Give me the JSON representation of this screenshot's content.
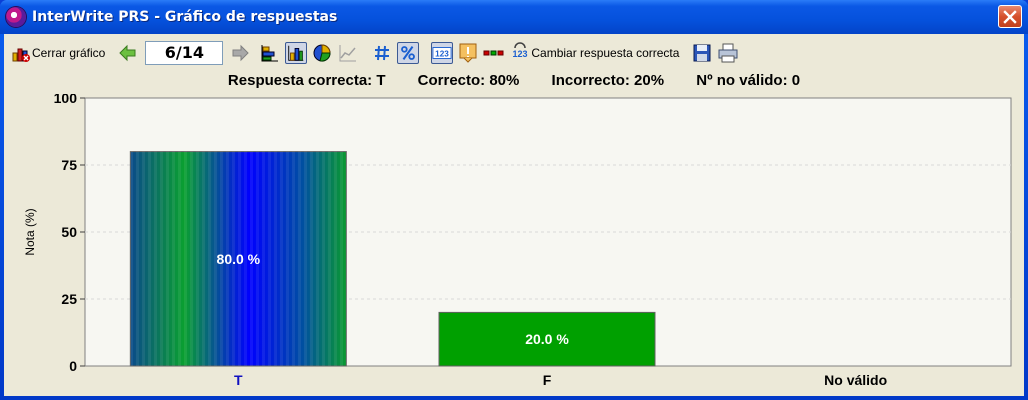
{
  "window": {
    "title": "InterWrite PRS - Gráfico de respuestas"
  },
  "toolbar": {
    "close_chart_label": "Cerrar gráfico",
    "page_indicator": "6/14",
    "change_answer_label": "Cambiar respuesta correcta"
  },
  "stats": {
    "correct_answer": "Respuesta correcta: T",
    "correct_pct": "Correcto: 80%",
    "incorrect_pct": "Incorrecto: 20%",
    "invalid_count": "Nº no válido: 0"
  },
  "colors": {
    "bar_T": "#0000ff",
    "bar_F": "#00a000",
    "accent": "#0b58e5"
  },
  "chart_data": {
    "type": "bar",
    "ylabel": "Nota (%)",
    "ylim": [
      0,
      100
    ],
    "yticks": [
      "0",
      "25",
      "50",
      "75",
      "100"
    ],
    "categories": [
      "T",
      "F",
      "No válido"
    ],
    "values": [
      80,
      20,
      0
    ],
    "data_labels": [
      "80.0 %",
      "20.0 %",
      ""
    ],
    "grid": true
  }
}
